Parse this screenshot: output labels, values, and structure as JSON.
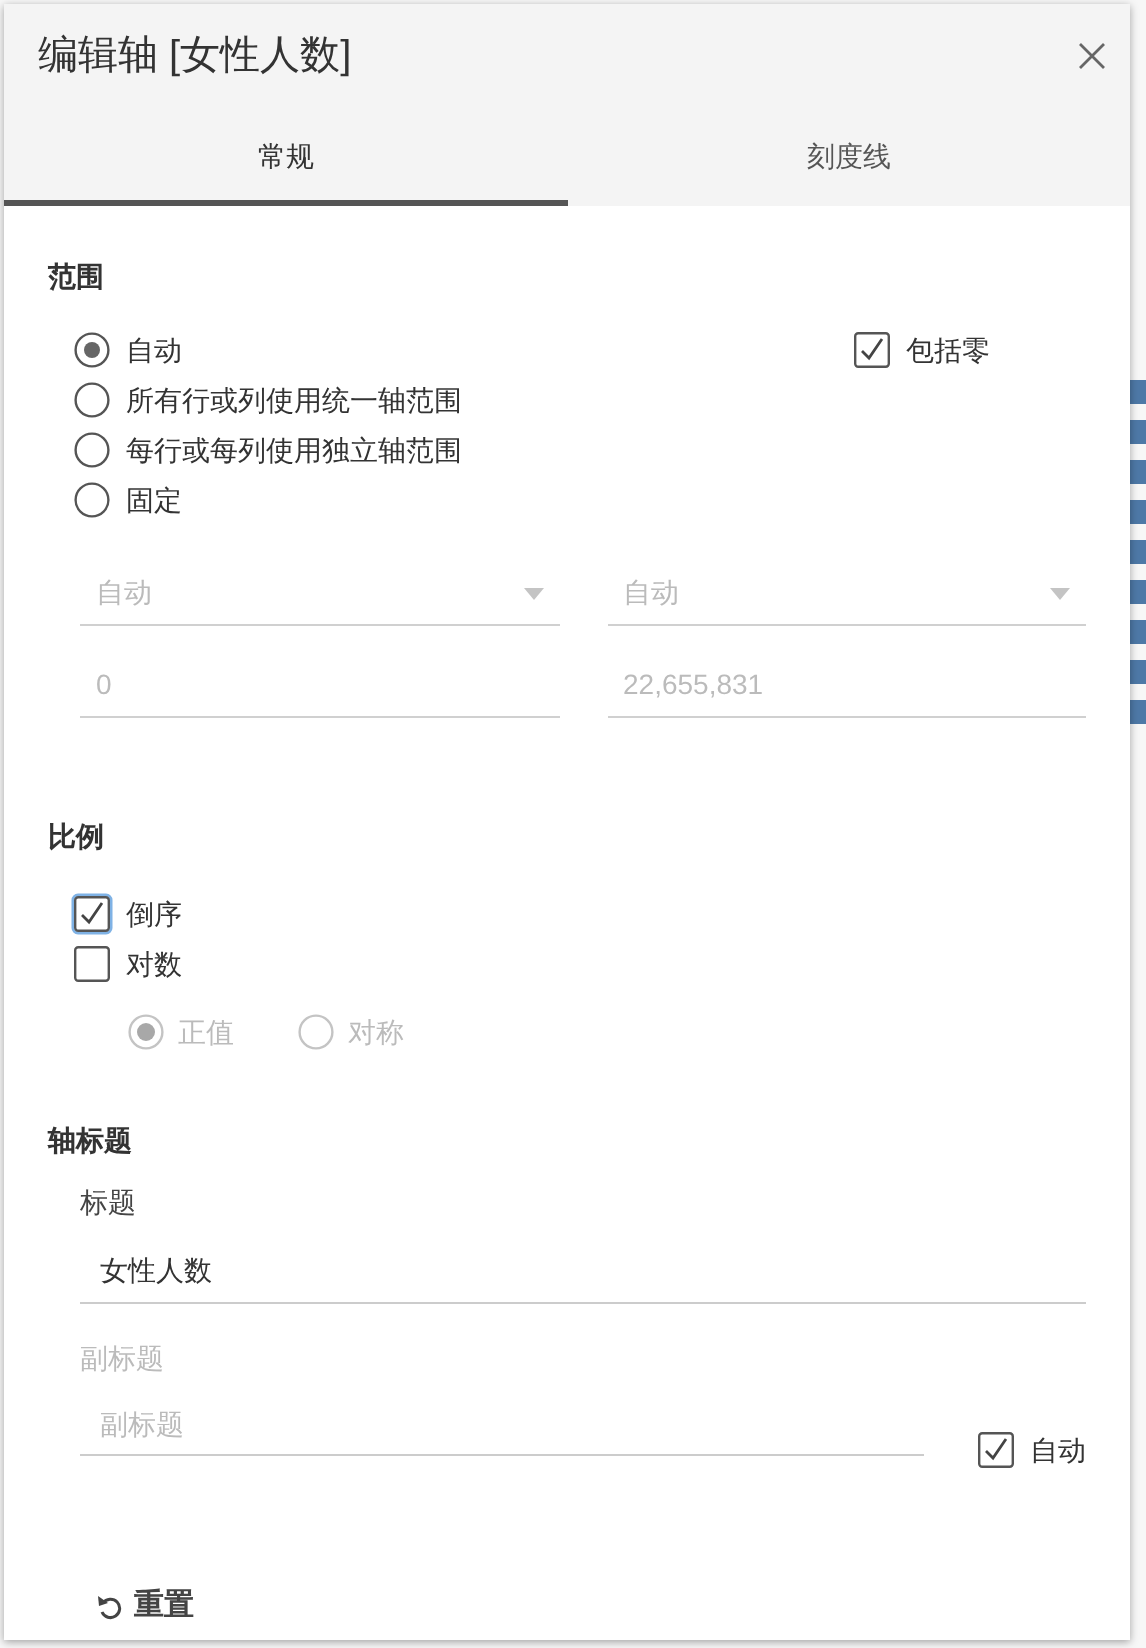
{
  "dialog": {
    "title": "编辑轴 [女性人数]"
  },
  "tabs": [
    {
      "label": "常规",
      "selected": true
    },
    {
      "label": "刻度线",
      "selected": false
    }
  ],
  "range": {
    "heading": "范围",
    "options": [
      {
        "label": "自动",
        "selected": true
      },
      {
        "label": "所有行或列使用统一轴范围",
        "selected": false
      },
      {
        "label": "每行或每列使用独立轴范围",
        "selected": false
      },
      {
        "label": "固定",
        "selected": false
      }
    ],
    "include_zero": {
      "label": "包括零",
      "checked": true
    },
    "dropdowns": [
      {
        "value": "自动",
        "disabled": true
      },
      {
        "value": "自动",
        "disabled": true
      }
    ],
    "inputs": [
      {
        "value": "0",
        "disabled": true
      },
      {
        "value": "22,655,831",
        "disabled": true
      }
    ]
  },
  "scale": {
    "heading": "比例",
    "checkboxes": [
      {
        "label": "倒序",
        "checked": true,
        "focused": true
      },
      {
        "label": "对数",
        "checked": false,
        "focused": false
      }
    ],
    "log_options": [
      {
        "label": "正值",
        "selected": true,
        "disabled": true
      },
      {
        "label": "对称",
        "selected": false,
        "disabled": true
      }
    ]
  },
  "axis_title": {
    "heading": "轴标题",
    "title_label": "标题",
    "title_value": "女性人数",
    "subtitle_label": "副标题",
    "subtitle_disabled": true,
    "subtitle_placeholder": "副标题",
    "auto": {
      "label": "自动",
      "checked": true
    }
  },
  "reset_button": {
    "label": "重置"
  }
}
